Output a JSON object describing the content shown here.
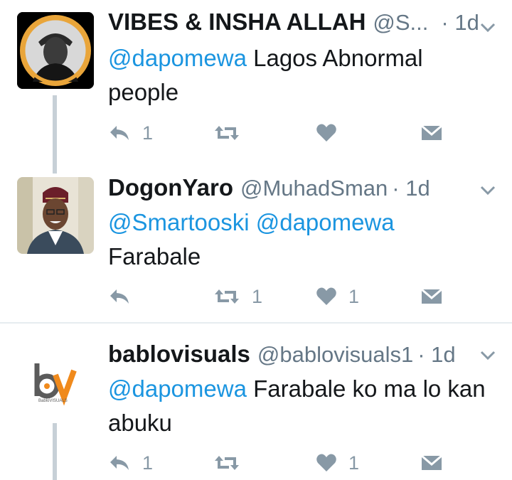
{
  "tweets": [
    {
      "name": "VIBES & INSHA ALLAH",
      "handle": "@S...",
      "time": "· 1d",
      "mentions": "@dapomewa",
      "text": " Lagos Abnormal people",
      "reply_count": "1",
      "retweet_count": "",
      "like_count": ""
    },
    {
      "name": "DogonYaro",
      "handle": "@MuhadSman",
      "time": "· 1d",
      "mentions": "@Smartooski @dapomewa",
      "text": "Farabale",
      "reply_count": "",
      "retweet_count": "1",
      "like_count": "1"
    },
    {
      "name": "bablovisuals",
      "handle": "@bablovisuals1",
      "time": "· 1d",
      "mentions": "@dapomewa",
      "text": " Farabale ko ma lo kan abuku",
      "reply_count": "1",
      "retweet_count": "",
      "like_count": "1",
      "logo_text": "BabloVISUALS"
    }
  ],
  "colors": {
    "mention": "#1b95e0",
    "icon": "#8899a6",
    "avatar_ring": "#e9a53a",
    "logo_orange": "#f08a1c",
    "logo_gray": "#5b5b5b"
  },
  "icons": [
    "reply-icon",
    "retweet-icon",
    "like-icon",
    "message-icon",
    "chevron-down-icon"
  ]
}
